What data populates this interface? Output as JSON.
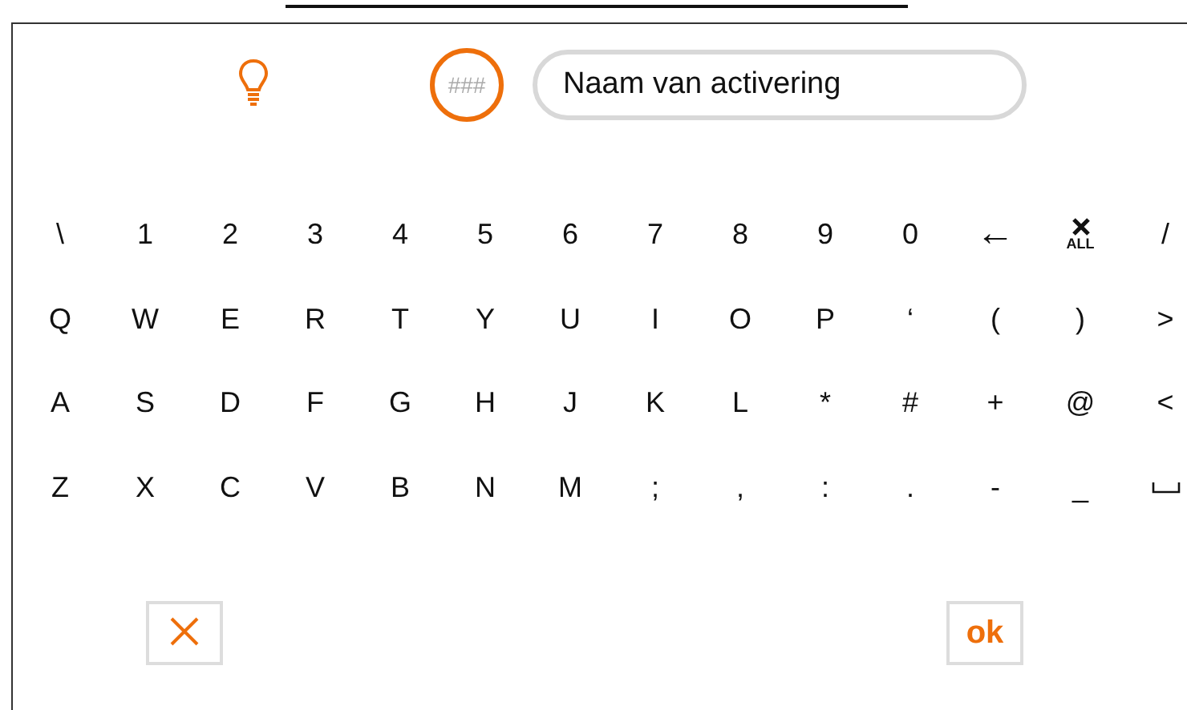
{
  "header": {
    "code_badge": "###",
    "name_field": {
      "value": "Naam van activering"
    }
  },
  "keyboard": {
    "rows": [
      [
        {
          "kind": "char",
          "label": "\\"
        },
        {
          "kind": "char",
          "label": "1"
        },
        {
          "kind": "char",
          "label": "2"
        },
        {
          "kind": "char",
          "label": "3"
        },
        {
          "kind": "char",
          "label": "4"
        },
        {
          "kind": "char",
          "label": "5"
        },
        {
          "kind": "char",
          "label": "6"
        },
        {
          "kind": "char",
          "label": "7"
        },
        {
          "kind": "char",
          "label": "8"
        },
        {
          "kind": "char",
          "label": "9"
        },
        {
          "kind": "char",
          "label": "0"
        },
        {
          "kind": "backspace",
          "label": "←"
        },
        {
          "kind": "clear",
          "label": "ALL"
        },
        {
          "kind": "char",
          "label": "/"
        }
      ],
      [
        {
          "kind": "char",
          "label": "Q"
        },
        {
          "kind": "char",
          "label": "W"
        },
        {
          "kind": "char",
          "label": "E"
        },
        {
          "kind": "char",
          "label": "R"
        },
        {
          "kind": "char",
          "label": "T"
        },
        {
          "kind": "char",
          "label": "Y"
        },
        {
          "kind": "char",
          "label": "U"
        },
        {
          "kind": "char",
          "label": "I"
        },
        {
          "kind": "char",
          "label": "O"
        },
        {
          "kind": "char",
          "label": "P"
        },
        {
          "kind": "char",
          "label": "‘"
        },
        {
          "kind": "char",
          "label": "("
        },
        {
          "kind": "char",
          "label": ")"
        },
        {
          "kind": "char",
          "label": ">"
        }
      ],
      [
        {
          "kind": "char",
          "label": "A"
        },
        {
          "kind": "char",
          "label": "S"
        },
        {
          "kind": "char",
          "label": "D"
        },
        {
          "kind": "char",
          "label": "F"
        },
        {
          "kind": "char",
          "label": "G"
        },
        {
          "kind": "char",
          "label": "H"
        },
        {
          "kind": "char",
          "label": "J"
        },
        {
          "kind": "char",
          "label": "K"
        },
        {
          "kind": "char",
          "label": "L"
        },
        {
          "kind": "char",
          "label": "*"
        },
        {
          "kind": "char",
          "label": "#"
        },
        {
          "kind": "char",
          "label": "+"
        },
        {
          "kind": "char",
          "label": "@"
        },
        {
          "kind": "char",
          "label": "<"
        }
      ],
      [
        {
          "kind": "char",
          "label": "Z"
        },
        {
          "kind": "char",
          "label": "X"
        },
        {
          "kind": "char",
          "label": "C"
        },
        {
          "kind": "char",
          "label": "V"
        },
        {
          "kind": "char",
          "label": "B"
        },
        {
          "kind": "char",
          "label": "N"
        },
        {
          "kind": "char",
          "label": "M"
        },
        {
          "kind": "char",
          "label": ";"
        },
        {
          "kind": "char",
          "label": ","
        },
        {
          "kind": "char",
          "label": ":"
        },
        {
          "kind": "char",
          "label": "."
        },
        {
          "kind": "char",
          "label": "-"
        },
        {
          "kind": "char",
          "label": "_"
        },
        {
          "kind": "space"
        }
      ]
    ]
  },
  "footer": {
    "ok_button": "ok"
  }
}
